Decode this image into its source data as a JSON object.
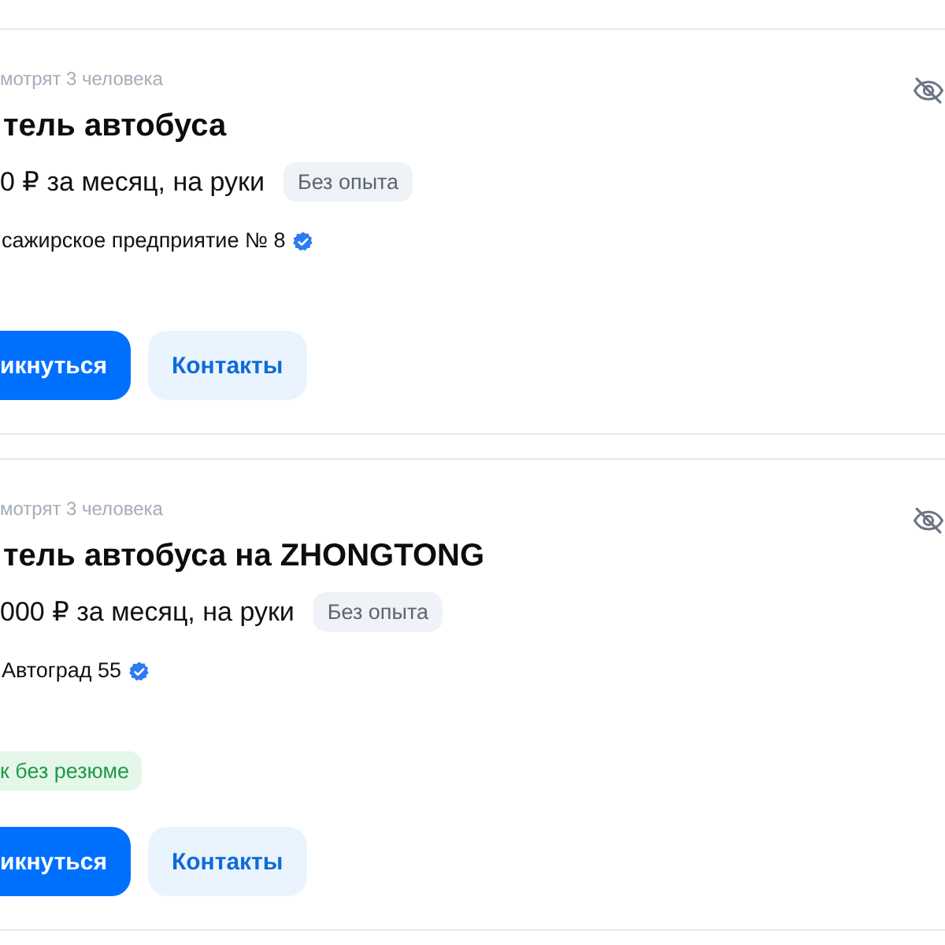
{
  "vacancies": [
    {
      "viewers": "мотрят 3 человека",
      "title": "тель автобуса",
      "salary": "0 ₽ за месяц, на руки",
      "experience": "Без опыта",
      "employer": "сажирское предприятие № 8",
      "employer_verified": true,
      "buttons": [
        {
          "label": "икнуться",
          "kind": "primary"
        },
        {
          "label": "Контакты",
          "kind": "secondary"
        }
      ]
    },
    {
      "viewers": "мотрят 3 человека",
      "title": "тель автобуса на ZHONGTONG",
      "salary": "000 ₽ за месяц, на руки",
      "experience": "Без опыта",
      "employer": "Автоград 55",
      "employer_verified": true,
      "tags": [
        {
          "label": "к без резюме",
          "kind": "success"
        }
      ],
      "buttons": [
        {
          "label": "икнуться",
          "kind": "primary"
        },
        {
          "label": "Контакты",
          "kind": "secondary"
        }
      ]
    }
  ]
}
